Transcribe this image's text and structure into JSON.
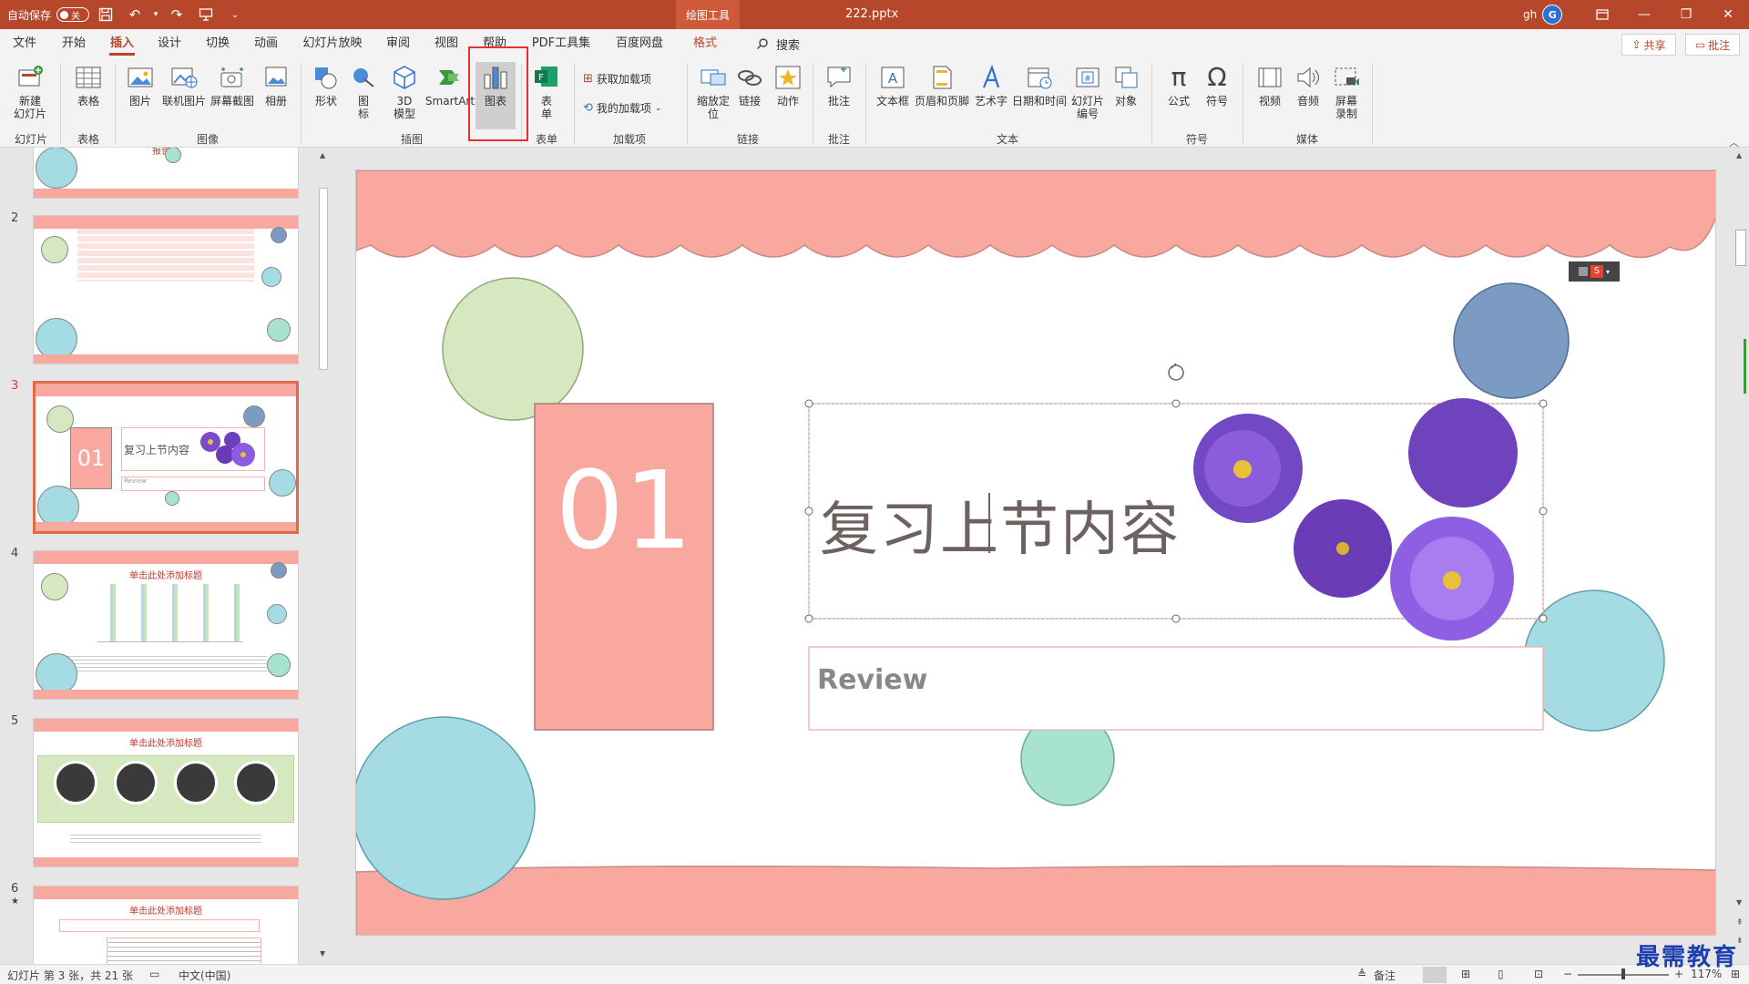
{
  "titlebar": {
    "autosave_label": "自动保存",
    "autosave_state": "关",
    "context_tab": "绘图工具",
    "doc_title": "222.pptx",
    "user_name": "gh",
    "user_initial": "G"
  },
  "tabs": [
    {
      "label": "文件"
    },
    {
      "label": "开始"
    },
    {
      "label": "插入",
      "active": true
    },
    {
      "label": "设计"
    },
    {
      "label": "切换"
    },
    {
      "label": "动画"
    },
    {
      "label": "幻灯片放映"
    },
    {
      "label": "审阅"
    },
    {
      "label": "视图"
    },
    {
      "label": "帮助"
    },
    {
      "label": "PDF工具集"
    },
    {
      "label": "百度网盘"
    },
    {
      "label": "格式",
      "context": true
    }
  ],
  "search_label": "搜索",
  "share_label": "共享",
  "comment_label": "批注",
  "ribbon": {
    "buttons": {
      "new_slide": "新建\n幻灯片",
      "table": "表格",
      "picture": "图片",
      "online_picture": "联机图片",
      "screenshot": "屏幕截图",
      "album": "相册",
      "shapes": "形状",
      "icons": "图\n标",
      "model3d": "3D\n模型",
      "smartart": "SmartArt",
      "chart": "图表",
      "forms": "表\n单",
      "get_addins": "获取加载项",
      "my_addins": "我的加载项",
      "zoom": "缩放定\n位",
      "link": "链接",
      "action": "动作",
      "comment": "批注",
      "textbox": "文本框",
      "header_footer": "页眉和页脚",
      "wordart": "艺术字",
      "datetime": "日期和时间",
      "slide_number": "幻灯片\n编号",
      "object": "对象",
      "equation": "公式",
      "symbol": "符号",
      "video": "视频",
      "audio": "音频",
      "screen_record": "屏幕\n录制"
    },
    "groups": {
      "slides": "幻灯片",
      "tables": "表格",
      "images": "图像",
      "illustrations": "插图",
      "forms": "表单",
      "addins": "加载项",
      "links": "链接",
      "comments": "批注",
      "text": "文本",
      "symbols": "符号",
      "media": "媒体"
    }
  },
  "thumbnails": [
    {
      "number": "",
      "title": "报告人"
    },
    {
      "number": "2",
      "title": ""
    },
    {
      "number": "3",
      "title": "复习上节内容",
      "num_box": "01",
      "sub": "Review",
      "selected": true
    },
    {
      "number": "4",
      "title": "单击此处添加标题"
    },
    {
      "number": "5",
      "title": "单击此处添加标题"
    },
    {
      "number": "6",
      "title": "单击此处添加标题",
      "star": "★"
    }
  ],
  "slide": {
    "number_box": "01",
    "title": "复习上节内容",
    "subtitle": "Review"
  },
  "status": {
    "slide_info": "幻灯片 第 3 张，共 21 张",
    "language": "中文(中国)",
    "notes": "备注",
    "zoom": "117%"
  },
  "watermark": "最需教育",
  "colors": {
    "brand": "#b7472a",
    "pink": "#f9a8a0",
    "green_circle": "#d6e8c0",
    "blue_circle": "#7b9bc2",
    "teal_circle": "#a5dbe3",
    "mint_circle": "#a8e3cf",
    "highlight": "#e8312c"
  }
}
